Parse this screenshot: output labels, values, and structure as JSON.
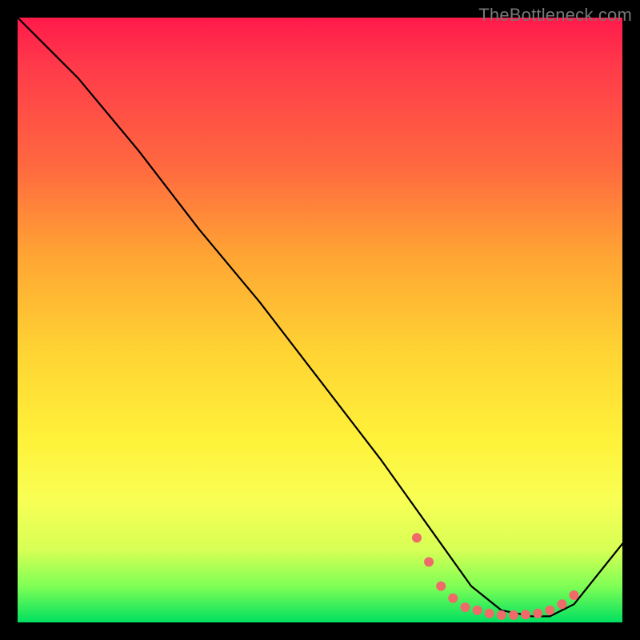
{
  "watermark": "TheBottleneck.com",
  "colors": {
    "background": "#000000",
    "marker": "#f06a6a",
    "line": "#000000",
    "gradient_top": "#ff1a4b",
    "gradient_bottom": "#00e060"
  },
  "chart_data": {
    "type": "line",
    "title": "",
    "xlabel": "",
    "ylabel": "",
    "xlim": [
      0,
      100
    ],
    "ylim": [
      0,
      100
    ],
    "series": [
      {
        "name": "curve",
        "x": [
          0,
          5,
          10,
          20,
          30,
          40,
          50,
          60,
          65,
          70,
          75,
          80,
          85,
          88,
          92,
          100
        ],
        "y": [
          100,
          95,
          90,
          78,
          65,
          53,
          40,
          27,
          20,
          13,
          6,
          2,
          1,
          1,
          3,
          13
        ]
      }
    ],
    "markers": {
      "note": "salmon dots along the valley / optimum region",
      "x": [
        66,
        68,
        70,
        72,
        74,
        76,
        78,
        80,
        82,
        84,
        86,
        88,
        90,
        92
      ],
      "y": [
        14,
        10,
        6,
        4,
        2.5,
        2,
        1.5,
        1.2,
        1.2,
        1.3,
        1.5,
        2,
        3,
        4.5
      ]
    },
    "annotations": []
  }
}
